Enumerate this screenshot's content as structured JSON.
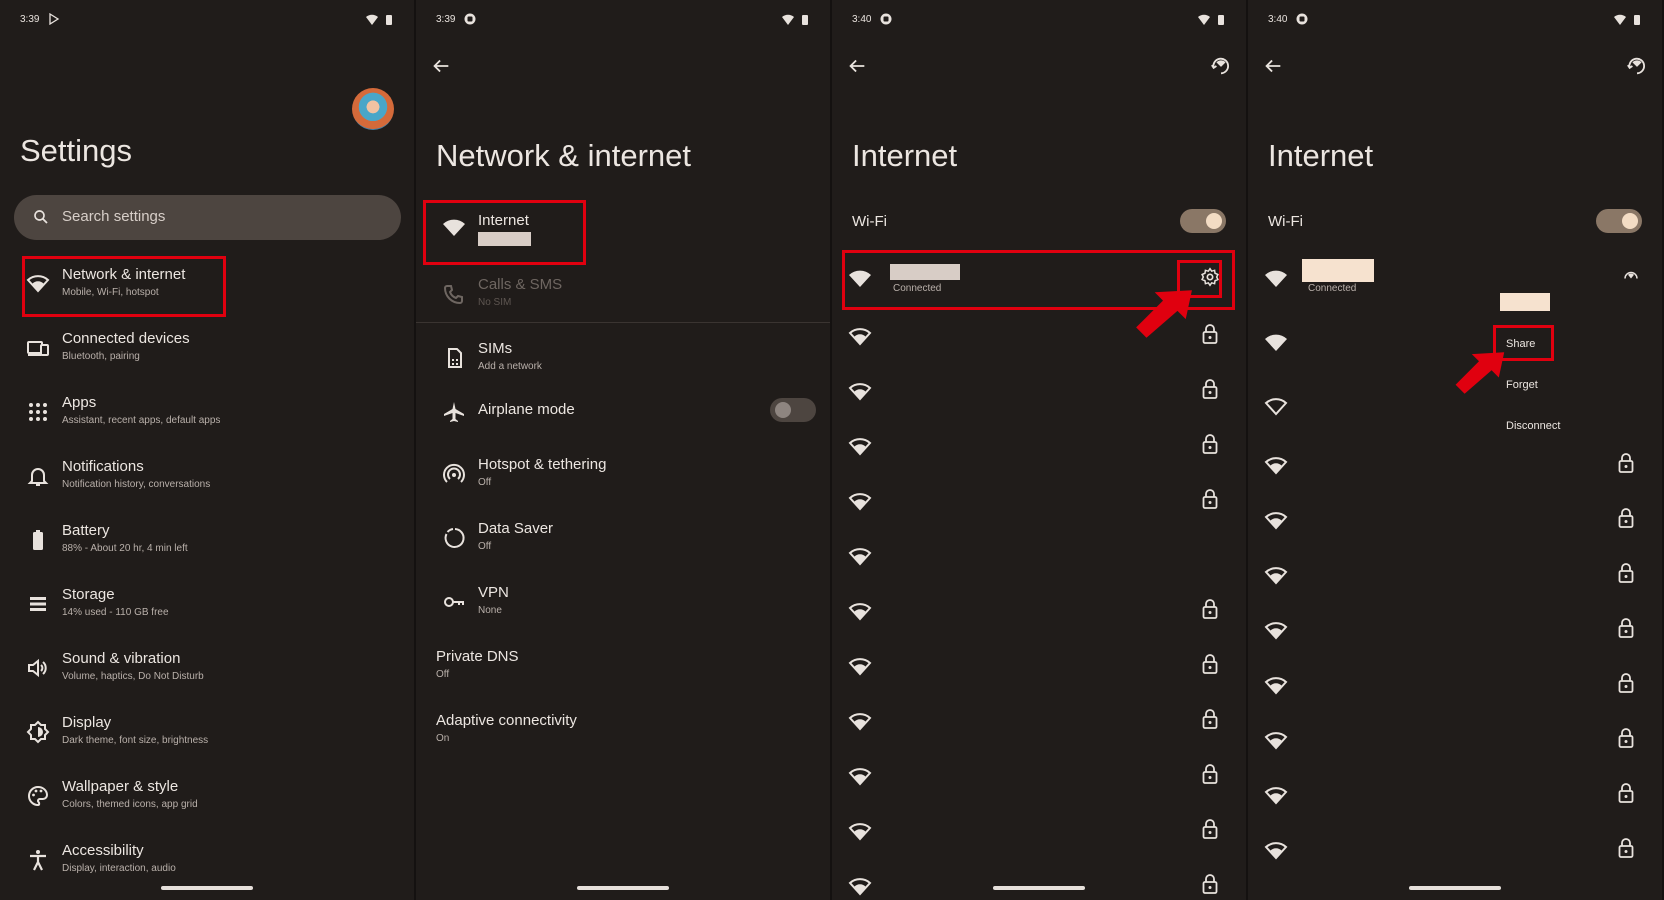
{
  "colors": {
    "background": "#201c1a",
    "highlight": "#e0000f",
    "toggle_on": "#f3dcc4",
    "toggle_track": "#8a7766",
    "redaction": "#f6e2cf",
    "redaction_grey": "#d8cdc6"
  },
  "panel1": {
    "time": "3:39",
    "title": "Settings",
    "search_placeholder": "Search settings",
    "items": [
      {
        "title": "Network & internet",
        "subtitle": "Mobile, Wi-Fi, hotspot",
        "icon": "wifi-icon"
      },
      {
        "title": "Connected devices",
        "subtitle": "Bluetooth, pairing",
        "icon": "devices-icon"
      },
      {
        "title": "Apps",
        "subtitle": "Assistant, recent apps, default apps",
        "icon": "apps-grid-icon"
      },
      {
        "title": "Notifications",
        "subtitle": "Notification history, conversations",
        "icon": "bell-icon"
      },
      {
        "title": "Battery",
        "subtitle": "88% - About 20 hr, 4 min left",
        "icon": "battery-icon"
      },
      {
        "title": "Storage",
        "subtitle": "14% used - 110 GB free",
        "icon": "storage-icon"
      },
      {
        "title": "Sound & vibration",
        "subtitle": "Volume, haptics, Do Not Disturb",
        "icon": "speaker-icon"
      },
      {
        "title": "Display",
        "subtitle": "Dark theme, font size, brightness",
        "icon": "brightness-icon"
      },
      {
        "title": "Wallpaper & style",
        "subtitle": "Colors, themed icons, app grid",
        "icon": "palette-icon"
      },
      {
        "title": "Accessibility",
        "subtitle": "Display, interaction, audio",
        "icon": "accessibility-icon"
      }
    ]
  },
  "panel2": {
    "time": "3:39",
    "title": "Network & internet",
    "internet": {
      "title": "Internet"
    },
    "calls": {
      "title": "Calls & SMS",
      "subtitle": "No SIM"
    },
    "sims": {
      "title": "SIMs",
      "subtitle": "Add a network"
    },
    "airplane": {
      "title": "Airplane mode",
      "on": false
    },
    "hotspot": {
      "title": "Hotspot & tethering",
      "subtitle": "Off"
    },
    "datasaver": {
      "title": "Data Saver",
      "subtitle": "Off"
    },
    "vpn": {
      "title": "VPN",
      "subtitle": "None"
    },
    "private_dns": {
      "title": "Private DNS",
      "subtitle": "Off"
    },
    "adaptive": {
      "title": "Adaptive connectivity",
      "subtitle": "On"
    }
  },
  "panel3": {
    "time": "3:40",
    "title": "Internet",
    "wifi_label": "Wi-Fi",
    "wifi_on": true,
    "connected_label": "Connected",
    "network_locked": [
      true,
      true,
      true,
      true,
      false,
      true,
      true,
      true,
      true,
      true,
      true
    ]
  },
  "panel4": {
    "time": "3:40",
    "title": "Internet",
    "wifi_label": "Wi-Fi",
    "wifi_on": true,
    "connected_label": "Connected",
    "menu": {
      "share": "Share",
      "forget": "Forget",
      "disconnect": "Disconnect"
    }
  }
}
